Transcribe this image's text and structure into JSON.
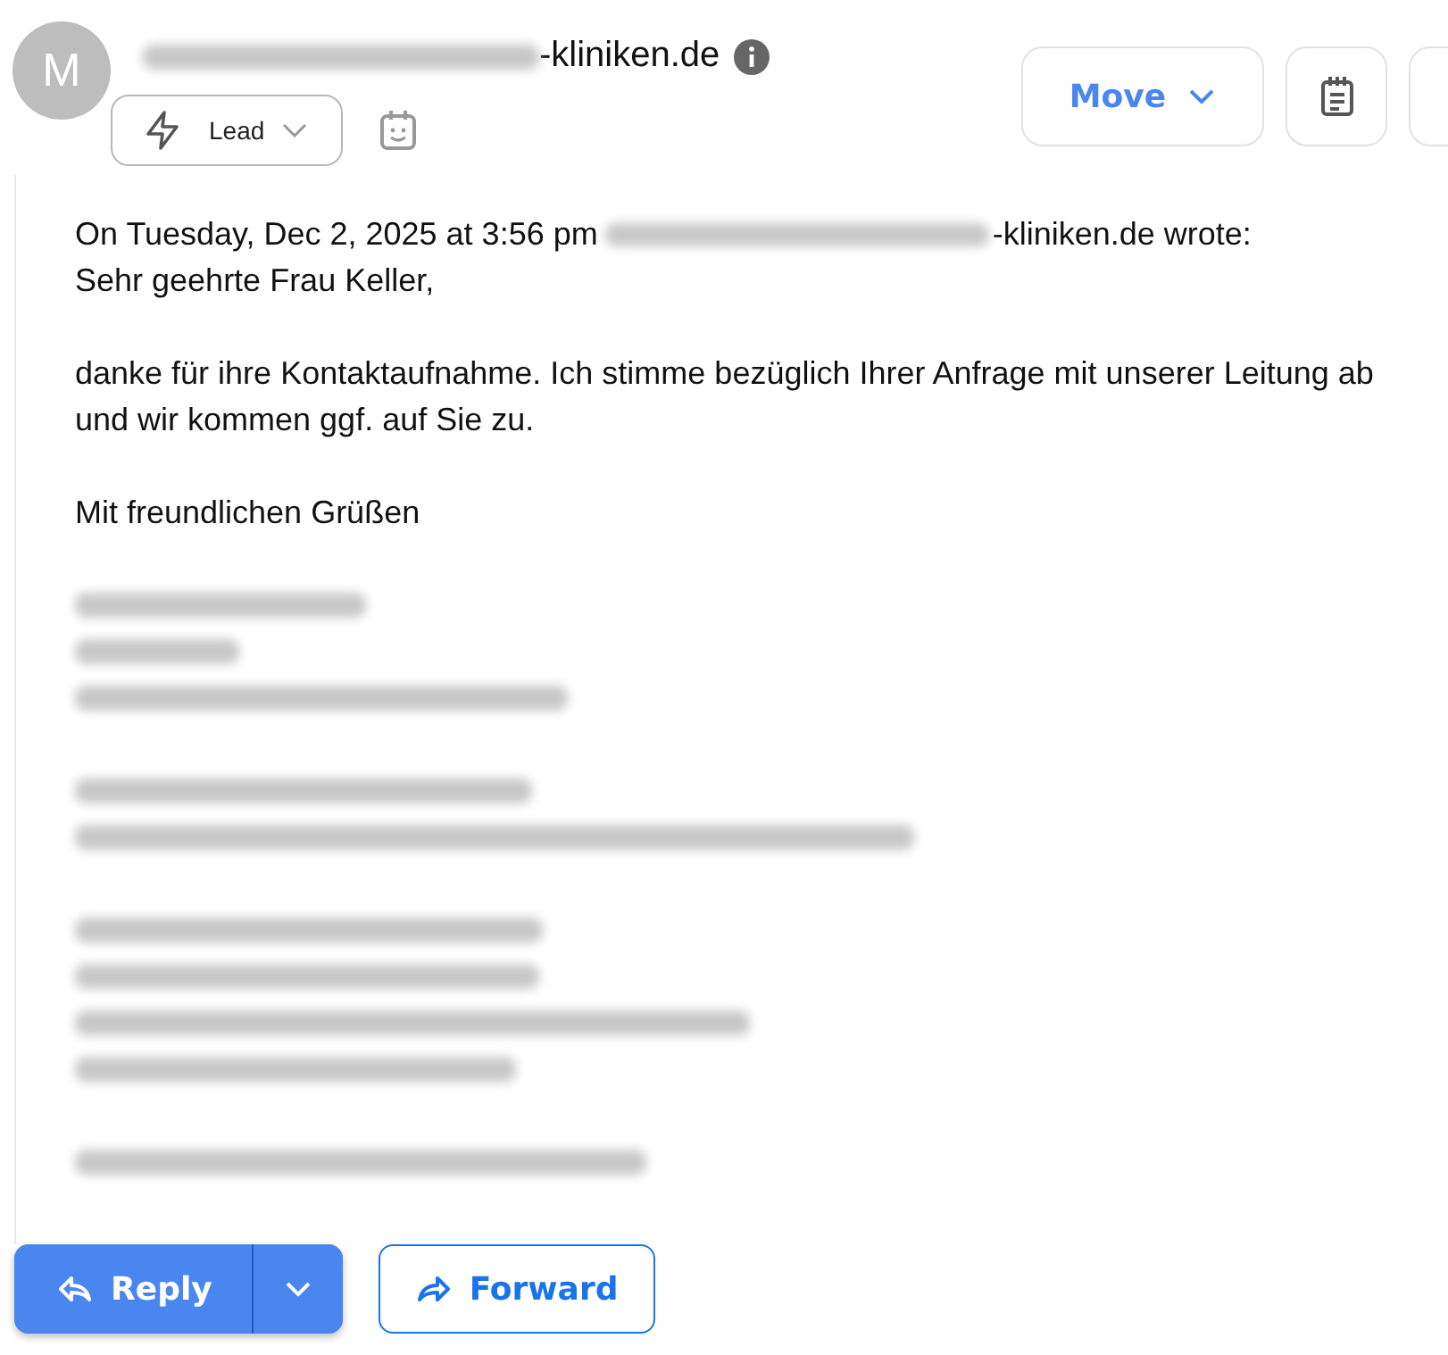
{
  "header": {
    "avatar": "M",
    "sender": {
      "blurred_prefix": true,
      "visible": "-kliniken.de"
    },
    "tag": {
      "label": "Lead"
    },
    "actions": [
      {
        "kind": "move",
        "label": "Move"
      },
      {
        "kind": "notes"
      },
      {
        "kind": "partial"
      }
    ]
  },
  "body": {
    "quote_line": {
      "before": "On Tuesday, Dec 2, 2025 at 3:56 pm",
      "after": "-kliniken.de wrote:"
    },
    "paragraphs": [
      "Sehr geehrte Frau Keller,",
      "danke für ihre Kontaktaufnahme. Ich stimme bezüglich Ihrer Anfrage mit unserer Leitung ab und wir kommen ggf. auf Sie zu.",
      "Mit freundlichen Grüßen"
    ],
    "signature_blurred": true
  },
  "footer": {
    "reply": "Reply",
    "forward": "Forward"
  }
}
